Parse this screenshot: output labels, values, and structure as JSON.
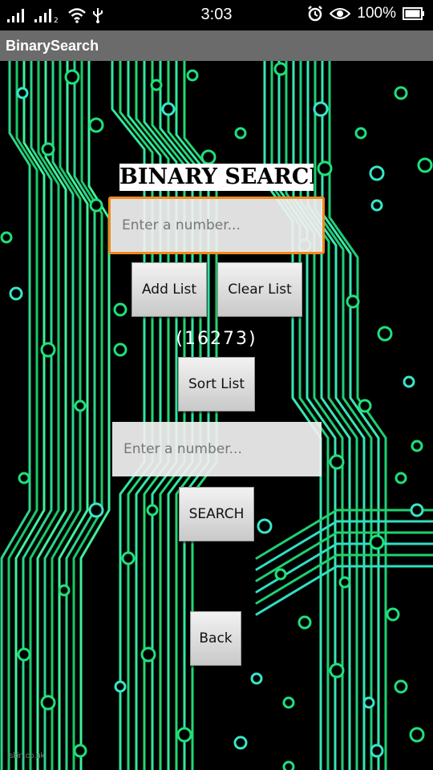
{
  "statusbar": {
    "time": "3:03",
    "battery_text": "100%",
    "icons": [
      "signal-icon",
      "signal-2-icon",
      "wifi-icon",
      "usb-icon",
      "alarm-icon",
      "eye-icon",
      "battery-icon"
    ],
    "signal2_label": "2"
  },
  "actionbar": {
    "title": "BinarySearch"
  },
  "main": {
    "heading": "BINARY SEARCH",
    "add_input": {
      "placeholder": "Enter a number...",
      "value": ""
    },
    "add_button": "Add List",
    "clear_button": "Clear List",
    "list_display": "(16273)",
    "sort_button": "Sort List",
    "search_input": {
      "placeholder": "Enter a number...",
      "value": ""
    },
    "search_button": "SEARCH",
    "back_button": "Back"
  },
  "background": {
    "credit": "iskin.co.uk"
  },
  "colors": {
    "circuit": "#1fe07a",
    "focus_border": "#f08a1c",
    "actionbar": "#6b6b6b"
  }
}
